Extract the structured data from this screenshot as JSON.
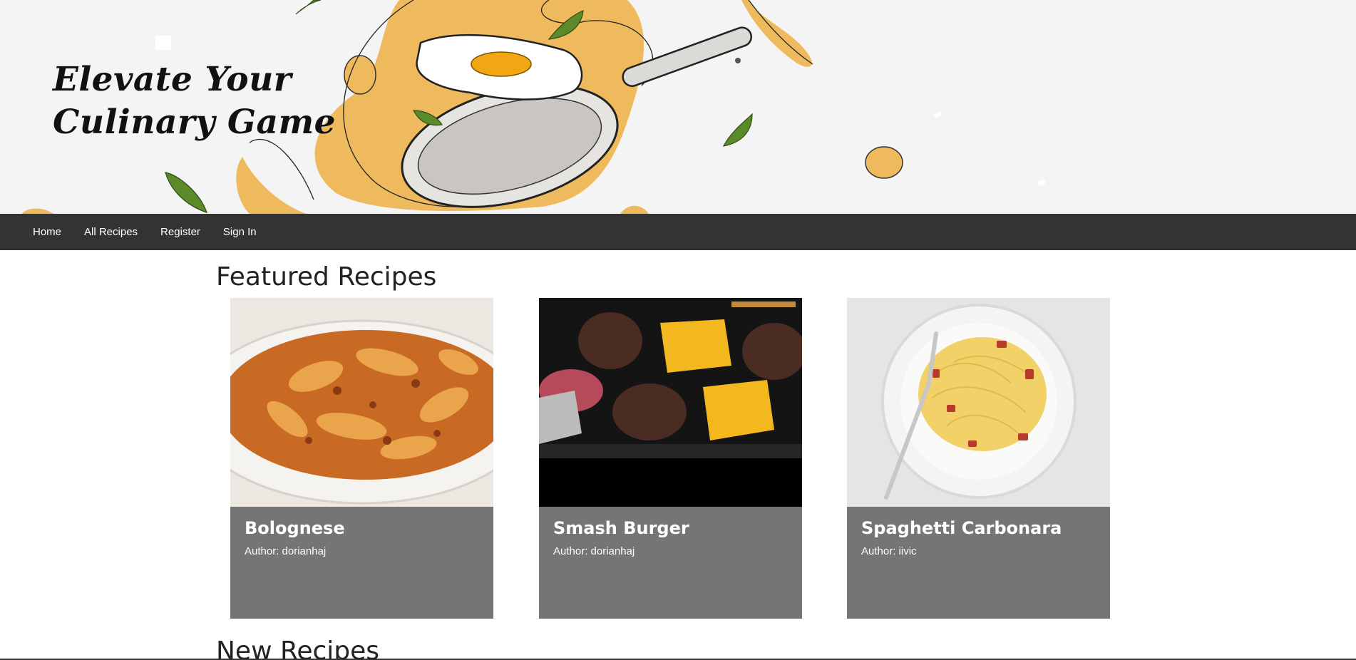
{
  "hero": {
    "title_line1": "Elevate Your",
    "title_line2": "Culinary Game"
  },
  "nav": {
    "items": [
      {
        "label": "Home"
      },
      {
        "label": "All Recipes"
      },
      {
        "label": "Register"
      },
      {
        "label": "Sign In"
      }
    ]
  },
  "featured": {
    "title": "Featured Recipes",
    "recipes": [
      {
        "name": "Bolognese",
        "author_label": "Author:",
        "author": "dorianhaj"
      },
      {
        "name": "Smash Burger",
        "author_label": "Author:",
        "author": "dorianhaj"
      },
      {
        "name": "Spaghetti Carbonara",
        "author_label": "Author:",
        "author": "iivic"
      }
    ]
  },
  "new_recipes": {
    "title": "New Recipes"
  },
  "colors": {
    "navbar": "#333333",
    "card": "#757575",
    "hero_accent": "#eeb85a",
    "leaf": "#5b8a2a"
  }
}
